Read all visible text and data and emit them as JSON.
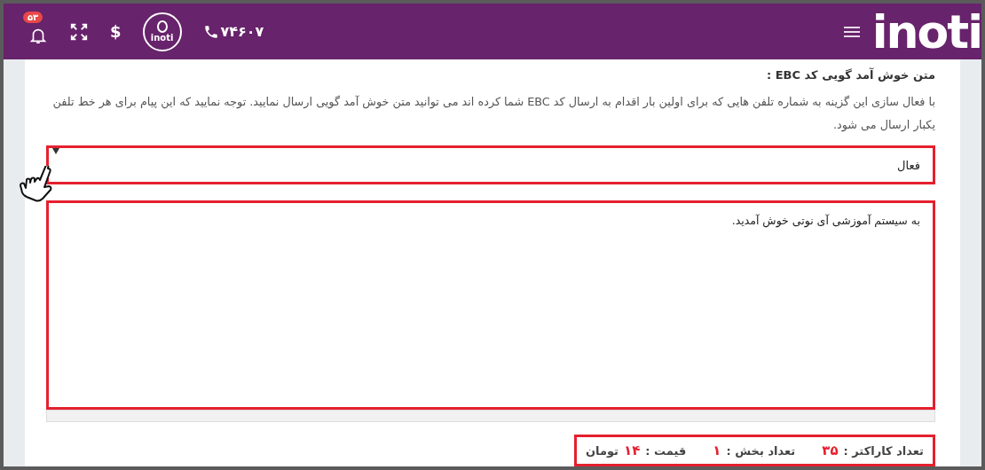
{
  "header": {
    "logo": "inoti",
    "phone": "۷۴۶۰۷",
    "emblem": "inoti",
    "currency": "$",
    "notifications": "۵۳"
  },
  "section": {
    "title": "متن خوش آمد گویی کد EBC :",
    "description": "با فعال سازی این گزینه به شماره تلفن هایی که برای اولین بار اقدام به ارسال کد EBC شما کرده اند می توانید متن خوش آمد گویی ارسال نمایید. توجه نمایید که این پیام برای هر خط تلفن یکبار ارسال می شود."
  },
  "select": {
    "value": "فعال",
    "highlighted": true
  },
  "message": {
    "value": "به سیستم آموزشی آی نوتی خوش آمدید.",
    "highlighted": true
  },
  "stats": {
    "highlighted": true,
    "items": [
      {
        "label": "تعداد کاراکتر :",
        "value": "۳۵"
      },
      {
        "label": "تعداد بخش :",
        "value": "۱"
      },
      {
        "label": "قیمت :",
        "value": "۱۴",
        "unit": "تومان"
      }
    ]
  }
}
